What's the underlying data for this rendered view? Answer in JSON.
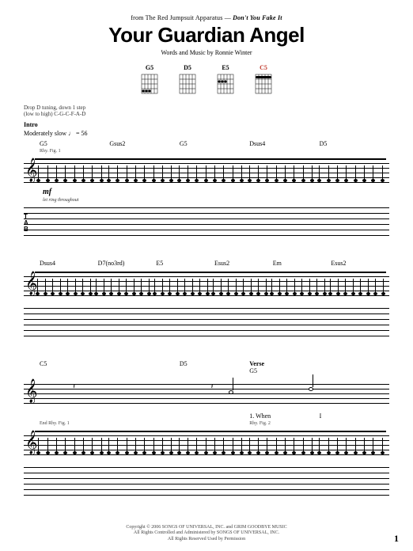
{
  "header": {
    "source_from": "from The Red Jumpsuit Apparatus — ",
    "source_album": "Don't You Fake It",
    "title": "Your Guardian Angel",
    "credits": "Words and Music by Ronnie Winter"
  },
  "chord_diagrams": [
    {
      "name": "G5"
    },
    {
      "name": "D5"
    },
    {
      "name": "E5"
    },
    {
      "name": "C5"
    }
  ],
  "tuning_note_line1": "Drop D tuning, down 1 step",
  "tuning_note_line2": "(low to high) C-G-C-F-A-D",
  "system1": {
    "section": "Intro",
    "tempo": "Moderately slow ♩ = 56",
    "rhy_fig": "Rhy. Fig. 1",
    "chords": [
      "G5",
      "Gsus2",
      "G5",
      "Dsus4",
      "D5"
    ],
    "dynamic": "mf",
    "ring": "let ring throughout"
  },
  "system2": {
    "chords": [
      "Dsus4",
      "D7(no3rd)",
      "E5",
      "Esus2",
      "Em",
      "Esus2"
    ]
  },
  "system3": {
    "chords_top": [
      "C5",
      "",
      "D5",
      "",
      "G5"
    ],
    "verse_label": "Verse",
    "lyric_prefix": "1. When",
    "lyric_word": "I",
    "rhy_fig_end": "End Rhy. Fig. 1",
    "rhy_fig_2": "Rhy. Fig. 2"
  },
  "footer": {
    "line1": "Copyright © 2006 SONGS OF UNIVERSAL, INC. and GRIM GOODBYE MUSIC",
    "line2": "All Rights Controlled and Administered by SONGS OF UNIVERSAL, INC.",
    "line3": "All Rights Reserved  Used by Permission"
  },
  "page_number": "1"
}
